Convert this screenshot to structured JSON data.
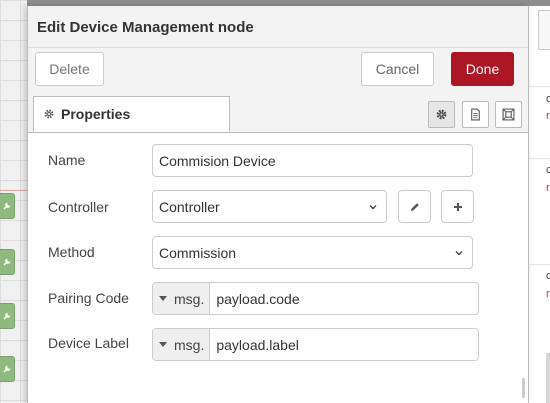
{
  "dialog": {
    "title": "Edit Device Management node",
    "buttons": {
      "delete": "Delete",
      "cancel": "Cancel",
      "done": "Done"
    }
  },
  "tabs": {
    "properties": "Properties"
  },
  "tab_icons": [
    "gear-icon",
    "description-icon",
    "appearance-icon"
  ],
  "form": {
    "name": {
      "label": "Name",
      "value": "Commision Device"
    },
    "controller": {
      "label": "Controller",
      "value": "Controller"
    },
    "method": {
      "label": "Method",
      "value": "Commission"
    },
    "pairing_code": {
      "label": "Pairing Code",
      "type": "msg.",
      "value": "payload.code"
    },
    "device_label": {
      "label": "Device Label",
      "type": "msg.",
      "value": "payload.label"
    }
  },
  "colors": {
    "accent": "#ad1625",
    "node": "#8fba7f"
  }
}
